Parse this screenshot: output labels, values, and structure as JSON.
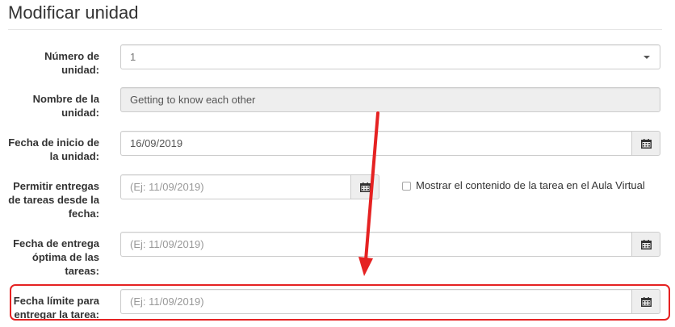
{
  "page": {
    "title": "Modificar unidad"
  },
  "form": {
    "unit_number": {
      "label": "Número de unidad:",
      "value": "1"
    },
    "unit_name": {
      "label": "Nombre de la unidad:",
      "value": "Getting to know each other"
    },
    "start_date": {
      "label": "Fecha de inicio de la unidad:",
      "value": "16/09/2019"
    },
    "allow_submissions": {
      "label": "Permitir entregas de tareas desde la fecha:",
      "placeholder": "(Ej: 11/09/2019)",
      "checkbox_label": "Mostrar el contenido de la tarea en el Aula Virtual",
      "checked": false
    },
    "optimal_date": {
      "label": "Fecha de entrega óptima de las tareas:",
      "placeholder": "(Ej: 11/09/2019)"
    },
    "deadline": {
      "label": "Fecha límite para entregar la tarea:",
      "placeholder": "(Ej: 11/09/2019)"
    }
  },
  "icons": {
    "calendar": "calendar-icon",
    "dropdown": "chevron-down-icon"
  },
  "colors": {
    "annotation": "#e52222",
    "border": "#cccccc",
    "addon_bg": "#eeeeee"
  }
}
